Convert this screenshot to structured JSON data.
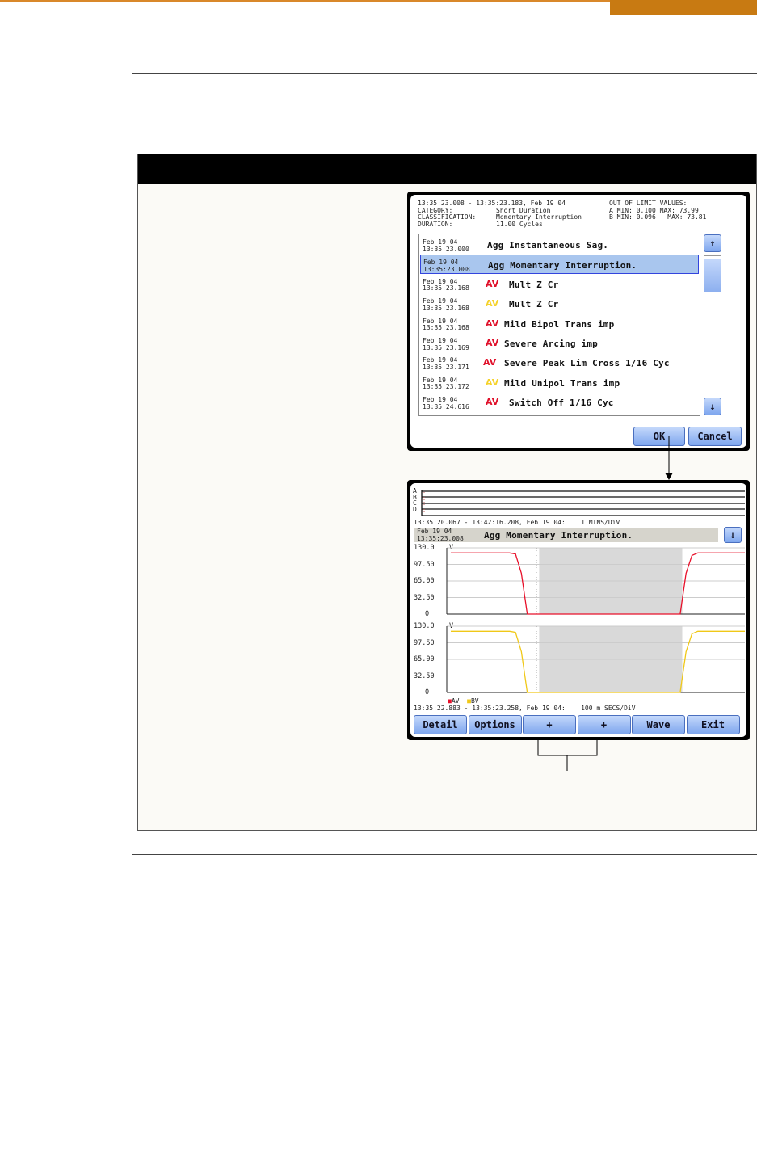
{
  "dialog": {
    "header": {
      "range": "13:35:23.008 - 13:35:23.183, Feb 19 04",
      "category_label": "CATEGORY:",
      "category": "Short Duration",
      "classification_label": "CLASSIFICATION:",
      "classification": "Momentary Interruption",
      "duration_label": "DURATION:",
      "duration": "11.00 Cycles",
      "out_of_limit_label": "OUT OF LIMIT VALUES:",
      "a_limits": "A MIN: 0.100 MAX: 73.99",
      "b_limits": "B MIN: 0.096   MAX: 73.81"
    },
    "events": [
      {
        "date": "Feb 19 04",
        "time": "13:35:23.000",
        "tag": "",
        "tag_color": "",
        "desc": "Agg Instantaneous Sag.",
        "selected": false
      },
      {
        "date": "Feb 19 04",
        "time": "13:35:23.008",
        "tag": "",
        "tag_color": "",
        "desc": "Agg Momentary Interruption.",
        "selected": true
      },
      {
        "date": "Feb 19 04",
        "time": "13:35:23.168",
        "tag": "AV",
        "tag_color": "#e0102a",
        "desc": "Mult Z Cr",
        "selected": false
      },
      {
        "date": "Feb 19 04",
        "time": "13:35:23.168",
        "tag": "AV",
        "tag_color": "#f5d22a",
        "desc": "Mult Z Cr",
        "selected": false
      },
      {
        "date": "Feb 19 04",
        "time": "13:35:23.168",
        "tag": "AV",
        "tag_color": "#e0102a",
        "desc": "Mild Bipol Trans imp",
        "selected": false
      },
      {
        "date": "Feb 19 04",
        "time": "13:35:23.169",
        "tag": "AV",
        "tag_color": "#e0102a",
        "desc": "Severe Arcing imp",
        "selected": false
      },
      {
        "date": "Feb 19 04",
        "time": "13:35:23.171",
        "tag": "AV",
        "tag_color": "#e0102a",
        "desc": "Severe Peak Lim Cross 1/16 Cyc",
        "selected": false
      },
      {
        "date": "Feb 19 04",
        "time": "13:35:23.172",
        "tag": "AV",
        "tag_color": "#f5d22a",
        "desc": "Mild Unipol Trans imp",
        "selected": false
      },
      {
        "date": "Feb 19 04",
        "time": "13:35:24.616",
        "tag": "AV",
        "tag_color": "#e0102a",
        "desc": "Switch Off 1/16 Cyc",
        "selected": false
      }
    ],
    "scroll_up": "↑",
    "scroll_down": "↓",
    "ok": "OK",
    "cancel": "Cancel"
  },
  "waveform": {
    "overview_channels": [
      "A",
      "B",
      "C",
      "D"
    ],
    "overview_range": "13:35:20.067 - 13:42:16.208, Feb 19 04:    1 MINS/DiV",
    "event_date": "Feb 19 04",
    "event_time": "13:35:23.008",
    "event_desc": "Agg Momentary Interruption.",
    "down_button": "↓",
    "unit": "V",
    "detail_range": "13:35:22.883 - 13:35:23.258, Feb 19 04:    100 m SECS/DiV",
    "buttons": [
      "Detail",
      "Options",
      "+",
      "+",
      "Wave",
      "Exit"
    ]
  },
  "chart_data": [
    {
      "type": "line",
      "ylim": [
        0,
        130
      ],
      "yticks": [
        "130.0",
        "97.50",
        "65.00",
        "32.50",
        "0"
      ],
      "series": [
        {
          "name": "AV",
          "color": "#e8102a",
          "values": [
            120,
            120,
            120,
            120,
            120,
            120,
            120,
            120,
            120,
            120,
            120,
            118,
            80,
            0,
            0,
            0,
            0,
            0,
            0,
            0,
            0,
            0,
            0,
            0,
            0,
            0,
            0,
            0,
            0,
            0,
            0,
            0,
            0,
            0,
            0,
            0,
            0,
            0,
            0,
            0,
            80,
            115,
            120,
            120,
            120,
            120,
            120,
            120,
            120,
            120,
            120
          ]
        }
      ],
      "shaded": [
        0.31,
        0.79
      ]
    },
    {
      "type": "line",
      "ylim": [
        0,
        130
      ],
      "yticks": [
        "130.0",
        "97.50",
        "65.00",
        "32.50",
        "0"
      ],
      "series": [
        {
          "name": "BV",
          "color": "#f0c818",
          "values": [
            120,
            120,
            120,
            120,
            120,
            120,
            120,
            120,
            120,
            120,
            120,
            118,
            80,
            0,
            0,
            0,
            0,
            0,
            0,
            0,
            0,
            0,
            0,
            0,
            0,
            0,
            0,
            0,
            0,
            0,
            0,
            0,
            0,
            0,
            0,
            0,
            0,
            0,
            0,
            0,
            80,
            115,
            120,
            120,
            120,
            120,
            120,
            120,
            120,
            120,
            120
          ]
        }
      ],
      "shaded": [
        0.31,
        0.79
      ]
    }
  ]
}
